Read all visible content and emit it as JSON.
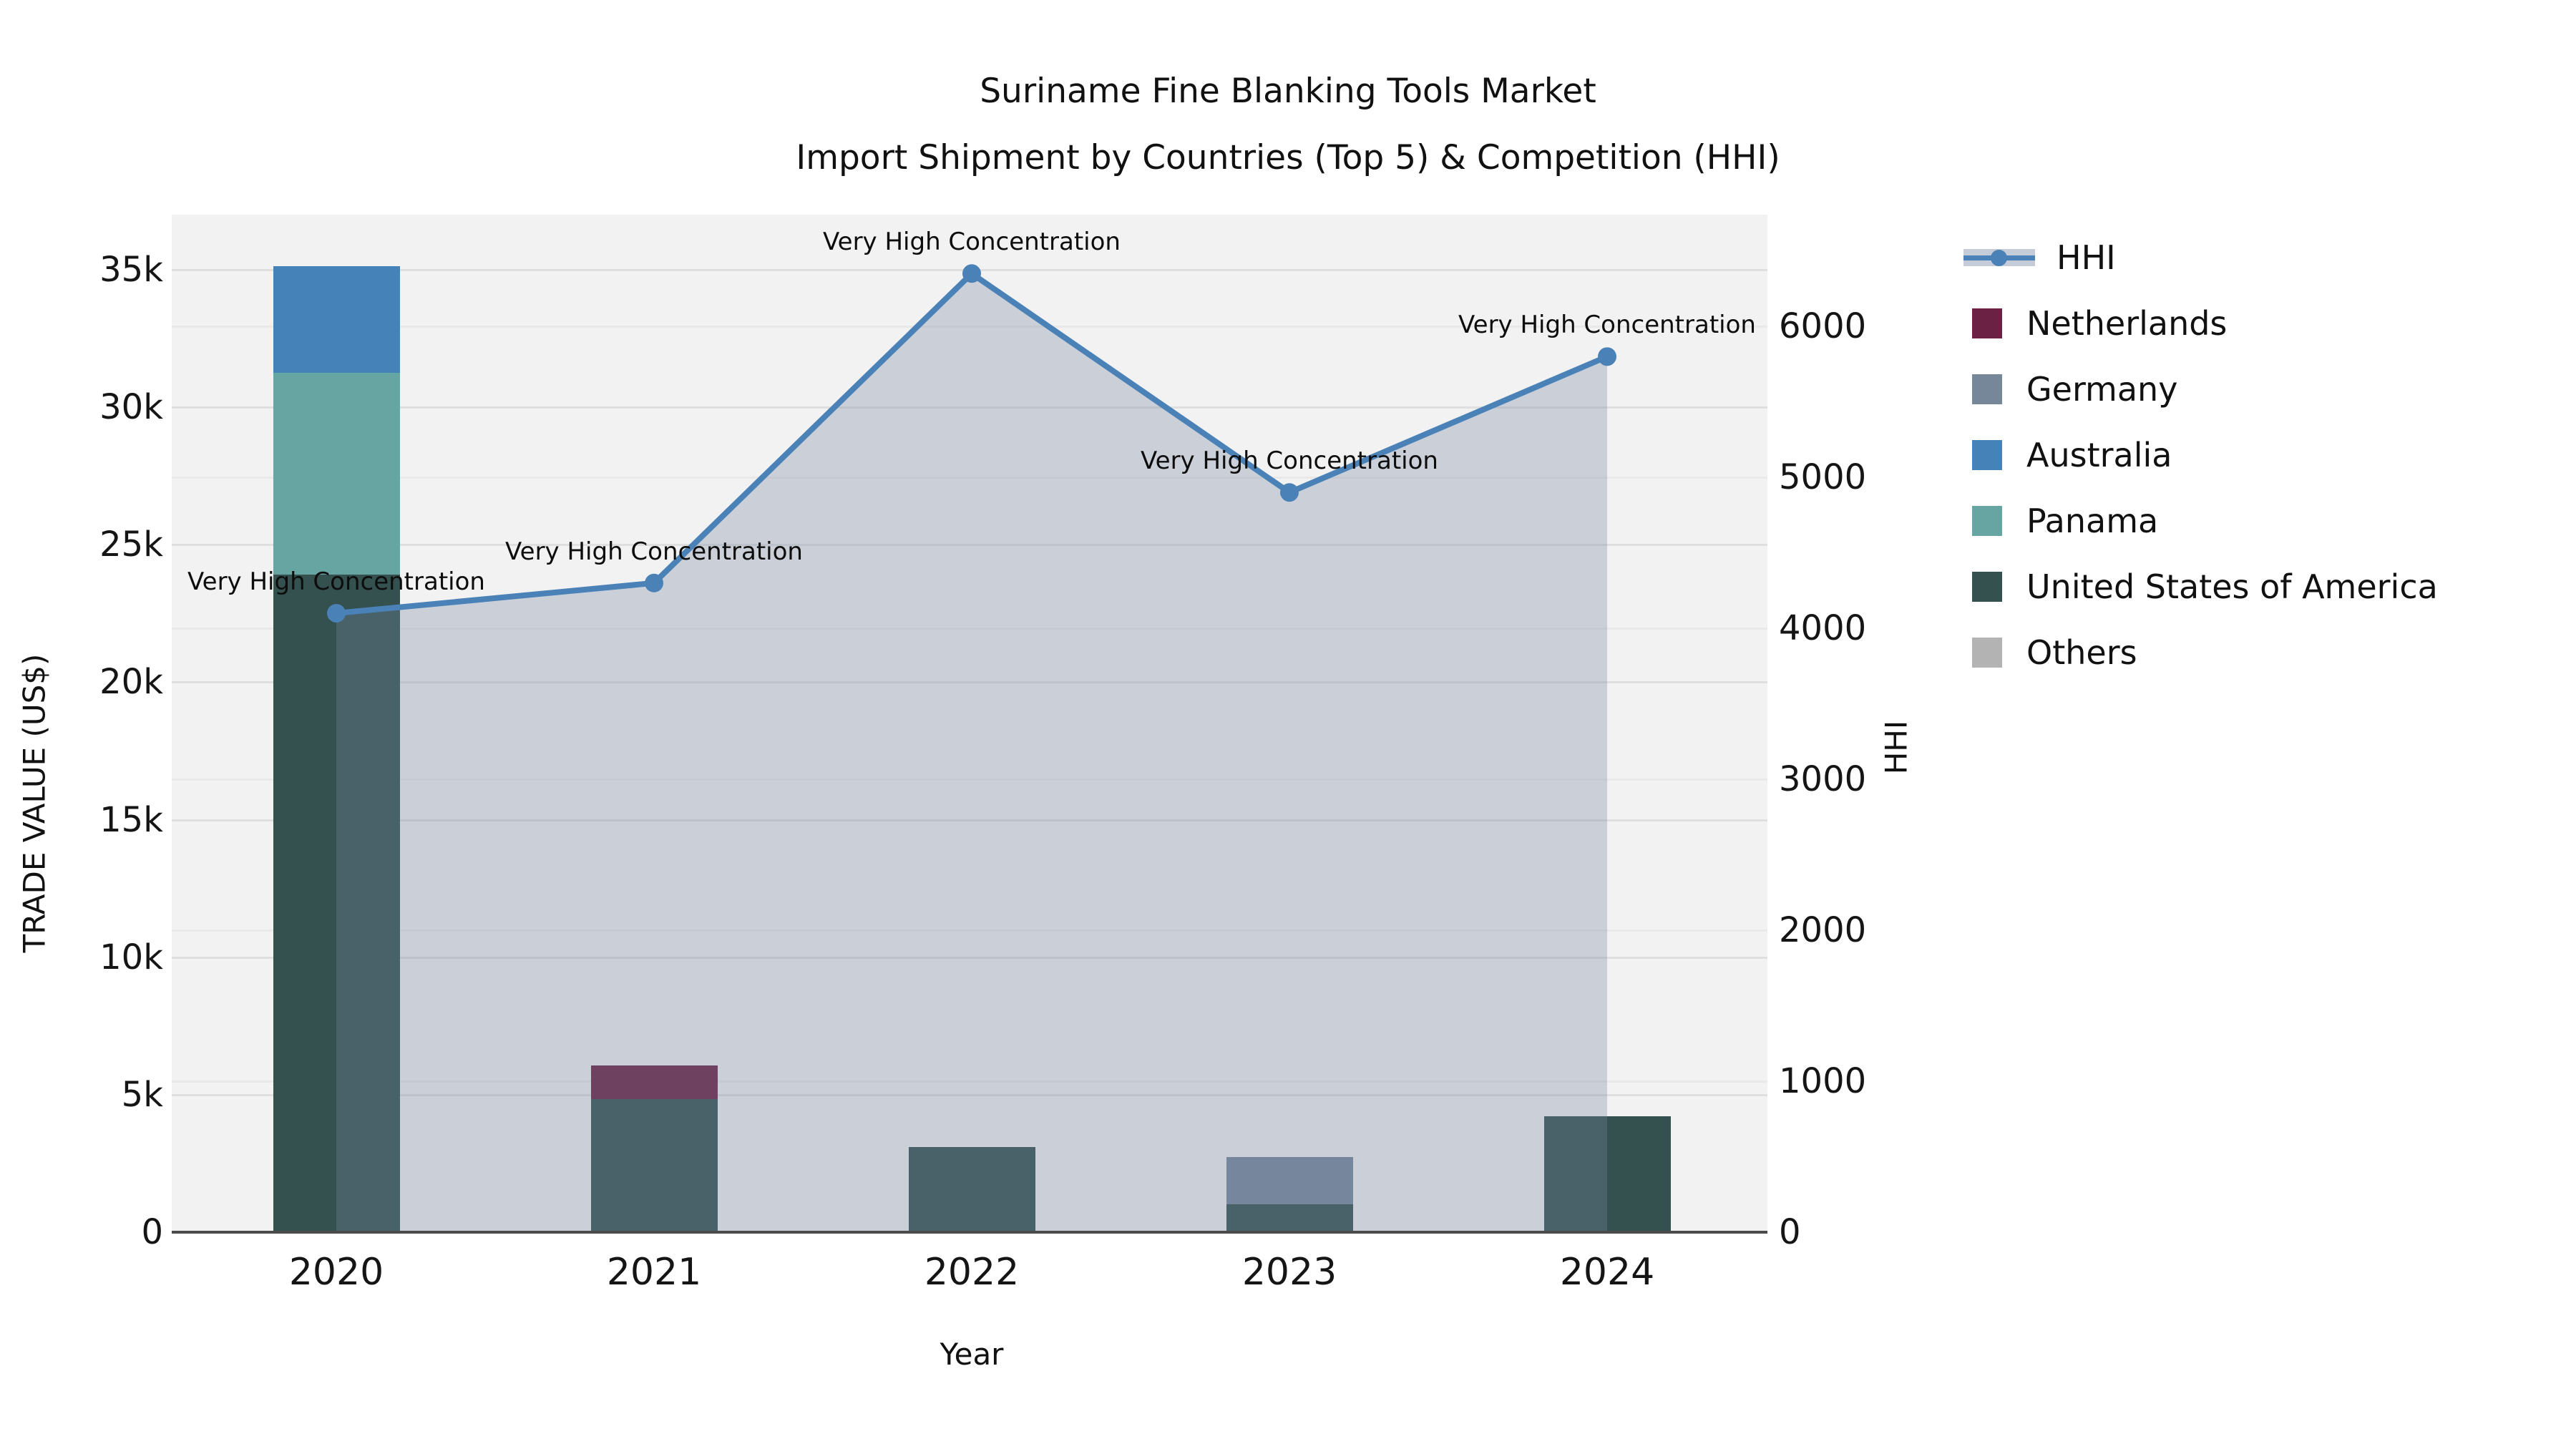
{
  "title": {
    "line1": "Suriname Fine Blanking Tools Market",
    "line2": "Import Shipment by Countries (Top 5) & Competition (HHI)"
  },
  "axes": {
    "x": {
      "label": "Year",
      "categories": [
        "2020",
        "2021",
        "2022",
        "2023",
        "2024"
      ]
    },
    "y_left": {
      "label": "TRADE VALUE (US$)",
      "tick_labels": [
        "0",
        "5k",
        "10k",
        "15k",
        "20k",
        "25k",
        "30k",
        "35k"
      ],
      "tick_values": [
        0,
        5000,
        10000,
        15000,
        20000,
        25000,
        30000,
        35000
      ],
      "max": 37000
    },
    "y_right": {
      "label": "HHI",
      "tick_labels": [
        "0",
        "1000",
        "2000",
        "3000",
        "4000",
        "5000",
        "6000"
      ],
      "tick_values": [
        0,
        1000,
        2000,
        3000,
        4000,
        5000,
        6000
      ],
      "max": 6740
    }
  },
  "chart_data": {
    "type": "bar",
    "subtype": "stacked-bars-with-line",
    "categories": [
      "2020",
      "2021",
      "2022",
      "2023",
      "2024"
    ],
    "series": [
      {
        "name": "United States of America",
        "color": "#34514f",
        "values": [
          23900,
          4840,
          3090,
          1010,
          4210
        ]
      },
      {
        "name": "Panama",
        "color": "#67a5a3",
        "values": [
          7350,
          0,
          0,
          0,
          0
        ]
      },
      {
        "name": "Australia",
        "color": "#4582b8",
        "values": [
          3880,
          0,
          0,
          0,
          0
        ]
      },
      {
        "name": "Germany",
        "color": "#76879a",
        "values": [
          0,
          0,
          0,
          1720,
          0
        ]
      },
      {
        "name": "Netherlands",
        "color": "#6b2143",
        "values": [
          0,
          1210,
          0,
          0,
          0
        ]
      },
      {
        "name": "Others",
        "color": "#b3b3b3",
        "values": [
          0,
          0,
          0,
          0,
          0
        ]
      }
    ],
    "line_series": {
      "name": "HHI",
      "color": "#4a82b8",
      "area_color": "rgba(119,135,162,0.32)",
      "values": [
        4100,
        4300,
        6350,
        4900,
        5800
      ]
    },
    "annotations": [
      {
        "text": "Very High Concentration",
        "category": "2020"
      },
      {
        "text": "Very High Concentration",
        "category": "2021"
      },
      {
        "text": "Very High Concentration",
        "category": "2022"
      },
      {
        "text": "Very High Concentration",
        "category": "2023"
      },
      {
        "text": "Very High Concentration",
        "category": "2024"
      }
    ],
    "title": "Suriname Fine Blanking Tools Market — Import Shipment by Countries (Top 5) & Competition (HHI)",
    "xlabel": "Year",
    "ylabel_left": "TRADE VALUE (US$)",
    "ylabel_right": "HHI",
    "ylim_left": [
      0,
      37000
    ],
    "ylim_right": [
      0,
      6740
    ],
    "grid": true,
    "legend_position": "right"
  },
  "legend": {
    "items": [
      {
        "label": "HHI",
        "type": "line",
        "color": "#4a82b8"
      },
      {
        "label": "Netherlands",
        "type": "swatch",
        "color": "#6b2143"
      },
      {
        "label": "Germany",
        "type": "swatch",
        "color": "#76879a"
      },
      {
        "label": "Australia",
        "type": "swatch",
        "color": "#4582b8"
      },
      {
        "label": "Panama",
        "type": "swatch",
        "color": "#67a5a3"
      },
      {
        "label": "United States of America",
        "type": "swatch",
        "color": "#34514f"
      },
      {
        "label": "Others",
        "type": "swatch",
        "color": "#b3b3b3"
      }
    ]
  }
}
